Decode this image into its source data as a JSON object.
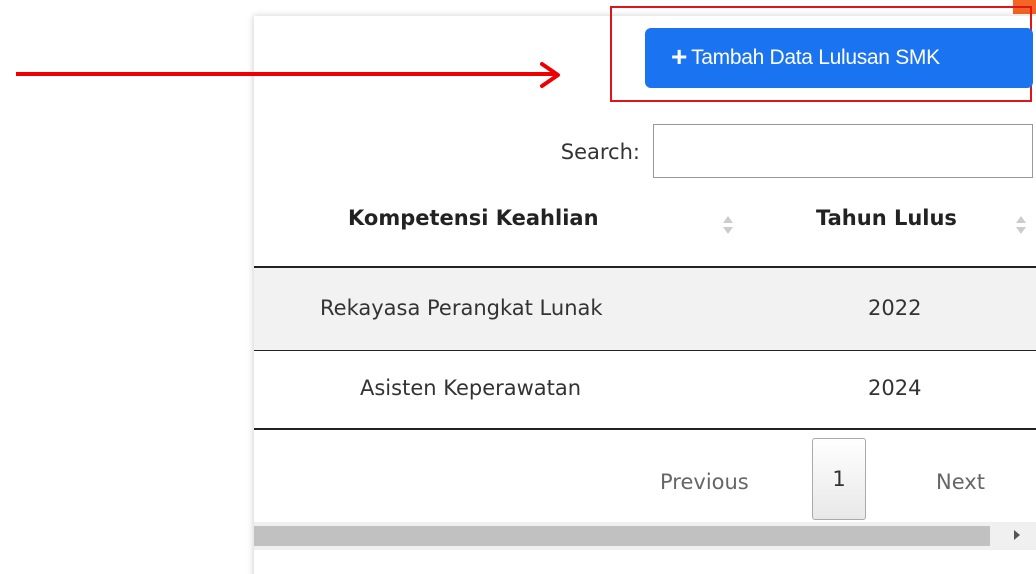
{
  "toolbar": {
    "add_button_label": "Tambah Data Lulusan SMK",
    "add_icon": "plus-icon"
  },
  "search": {
    "label": "Search:",
    "value": "",
    "placeholder": ""
  },
  "table": {
    "columns": [
      "Kompetensi Keahlian",
      "Tahun Lulus"
    ],
    "rows": [
      [
        "Rekayasa Perangkat Lunak",
        "2022"
      ],
      [
        "Asisten Keperawatan",
        "2024"
      ]
    ]
  },
  "pagination": {
    "previous_label": "Previous",
    "current_page": "1",
    "next_label": "Next"
  },
  "colors": {
    "accent": "#1a73f0",
    "annotation": "#e0151b",
    "corner": "#f26522"
  },
  "icons": [
    "arrow-right-icon",
    "plus-icon",
    "sort-icon",
    "scroll-right-icon"
  ]
}
